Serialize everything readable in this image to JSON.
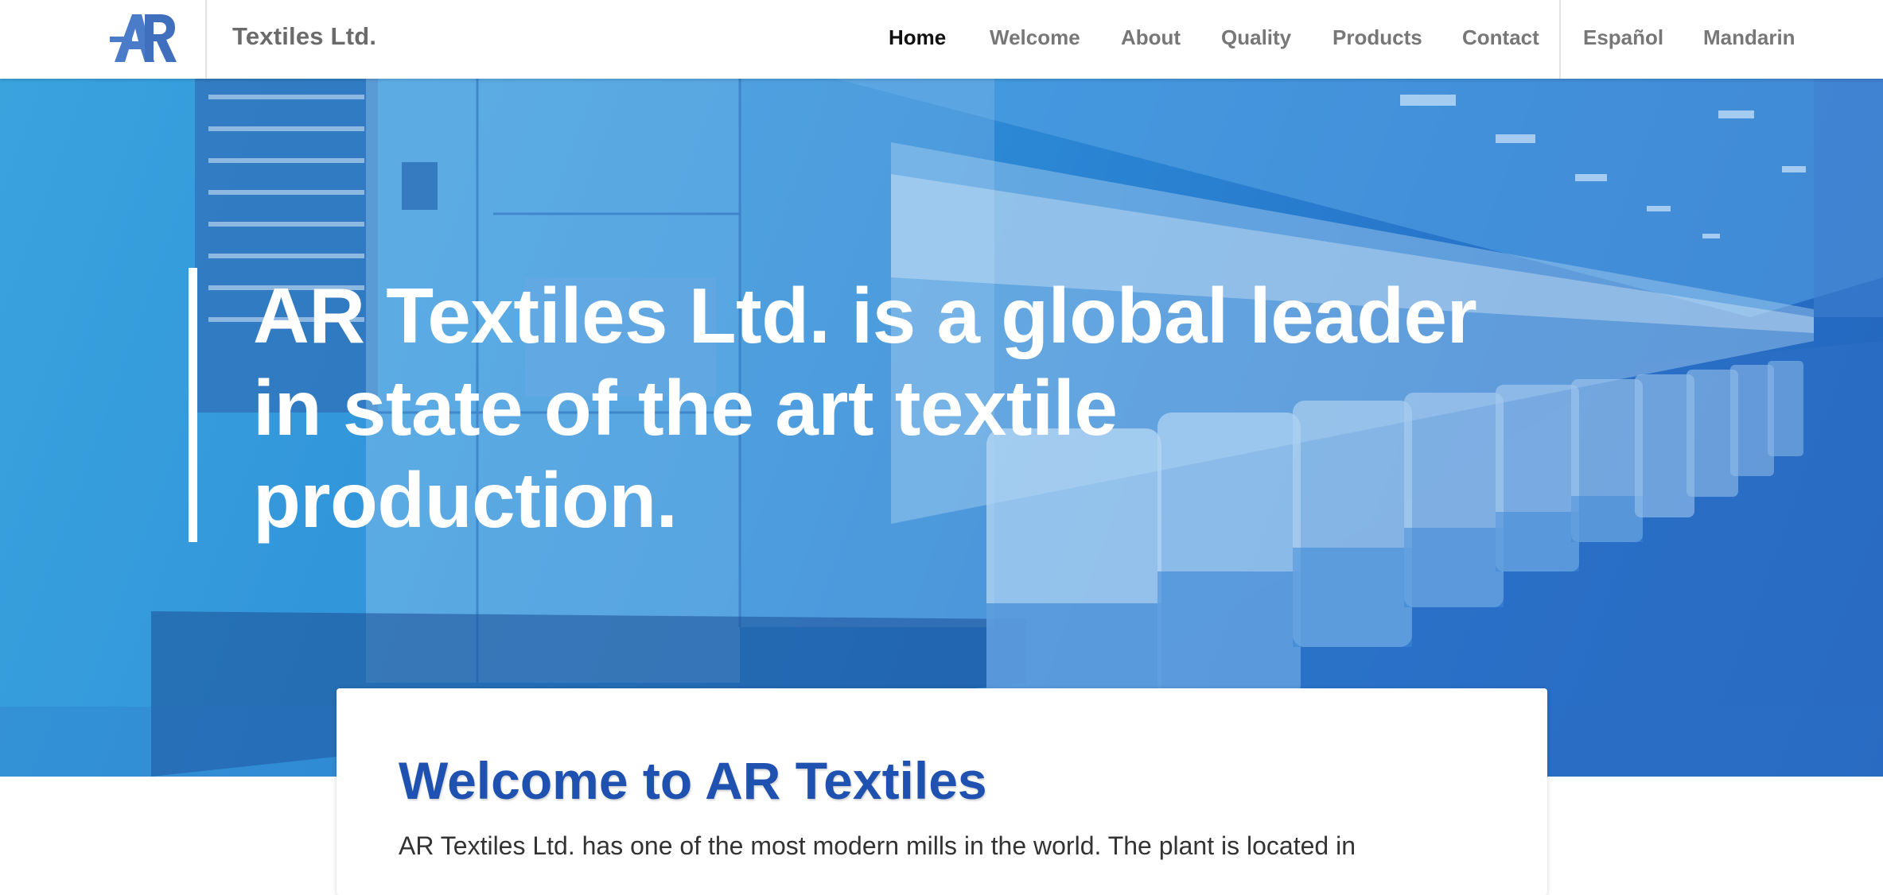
{
  "brand": {
    "logo_text": "AR",
    "name": "Textiles Ltd."
  },
  "nav": {
    "items": [
      {
        "label": "Home",
        "active": true
      },
      {
        "label": "Welcome",
        "active": false
      },
      {
        "label": "About",
        "active": false
      },
      {
        "label": "Quality",
        "active": false
      },
      {
        "label": "Products",
        "active": false
      },
      {
        "label": "Contact",
        "active": false
      }
    ],
    "languages": [
      {
        "label": "Español"
      },
      {
        "label": "Mandarin"
      }
    ]
  },
  "hero": {
    "headline": "AR Textiles Ltd. is a global leader in state of the art textile production."
  },
  "welcome": {
    "title": "Welcome to AR Textiles",
    "text": "AR Textiles Ltd. has one of the most modern mills in the world. The plant is located in"
  },
  "colors": {
    "accent_blue": "#1f52b0",
    "hero_blue": "#2d8ed8",
    "logo_blue": "#4a7cc9",
    "nav_active": "#111111",
    "nav_inactive": "#777777"
  }
}
